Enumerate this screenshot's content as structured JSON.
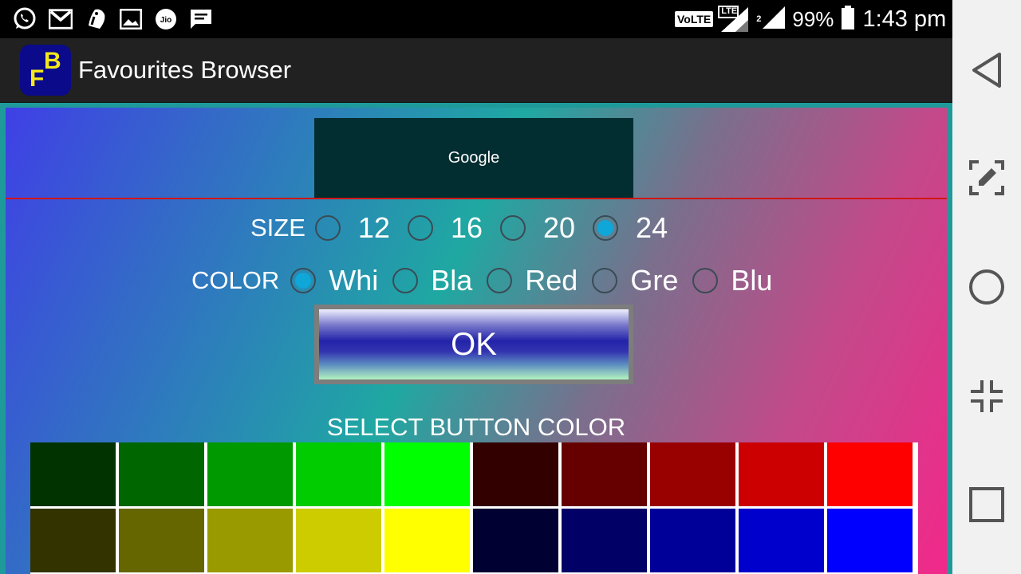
{
  "status_bar": {
    "icons": [
      "whatsapp-icon",
      "gmail-icon",
      "info-icon",
      "gallery-icon",
      "jio-icon",
      "message-icon"
    ],
    "volte": "VoLTE",
    "lte": "LTE",
    "sim1": "1",
    "sim2": "2",
    "battery": "99%",
    "time": "1:43 pm"
  },
  "app_bar": {
    "logo_text_f": "F",
    "logo_text_b": "B",
    "title": "Favourites Browser"
  },
  "preview": {
    "text": "Google"
  },
  "size": {
    "label": "SIZE",
    "options": [
      "12",
      "16",
      "20",
      "24"
    ],
    "selected": "24"
  },
  "color": {
    "label": "COLOR",
    "options": [
      "Whi",
      "Bla",
      "Red",
      "Gre",
      "Blu"
    ],
    "selected": "Whi"
  },
  "ok_button": {
    "label": "OK"
  },
  "button_color": {
    "title": "SELECT BUTTON COLOR",
    "rows": [
      [
        "#003300",
        "#006600",
        "#009900",
        "#00cc00",
        "#00ff00",
        "#330000",
        "#660000",
        "#990000",
        "#cc0000",
        "#ff0000"
      ],
      [
        "#333300",
        "#666600",
        "#999900",
        "#cccc00",
        "#ffff00",
        "#000033",
        "#000066",
        "#000099",
        "#0000cc",
        "#0000ff"
      ]
    ]
  },
  "nav": [
    "back-icon",
    "screenshot-edit-icon",
    "home-icon",
    "collapse-icon",
    "recents-icon"
  ]
}
